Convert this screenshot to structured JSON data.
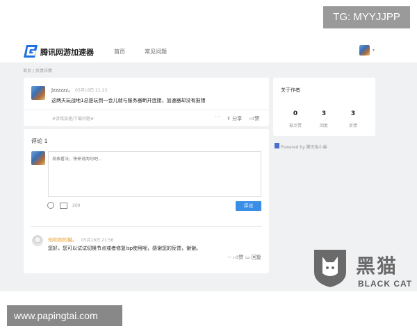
{
  "watermark": {
    "tg": "TG: MYYJJPP",
    "url": "www.papingtai.com",
    "brand_cn": "黑猫",
    "brand_en": "BLACK CAT"
  },
  "nav": {
    "brand": "腾讯网游加速器",
    "home": "首页",
    "faq": "常见问题",
    "caret": "▾"
  },
  "breadcrumb": "首页 / 反馈详情",
  "post": {
    "user": "Jzzzzzz。",
    "time": "05月16日 21:23",
    "content": "这两天玩战地1总是玩到一会儿就与服务器断开连接，加速器却没有报错",
    "tag": "#游戏加速/下载问题#",
    "more": "···",
    "share": "分享",
    "like": "赞"
  },
  "comments": {
    "title": "评论 1",
    "placeholder": "发表看法，快来说两句吧...",
    "count": "200",
    "submit": "评论",
    "reply": {
      "user": "他和她的猫。",
      "time": "05月16日 21:56",
      "content": "您好，您可以试试切换节点或者修复lsp使用呢，感谢您的反馈，谢谢。",
      "more": "···",
      "like": "赞",
      "reply": "回复"
    }
  },
  "author": {
    "title": "关于作者",
    "stats": [
      {
        "num": "0",
        "label": "被点赞"
      },
      {
        "num": "3",
        "label": "回复"
      },
      {
        "num": "3",
        "label": "反馈"
      }
    ]
  },
  "powered": "Powered by 腾讯兔小巢",
  "colors": {
    "accent": "#3a8ee6",
    "reply_user": "#e6a23c"
  }
}
